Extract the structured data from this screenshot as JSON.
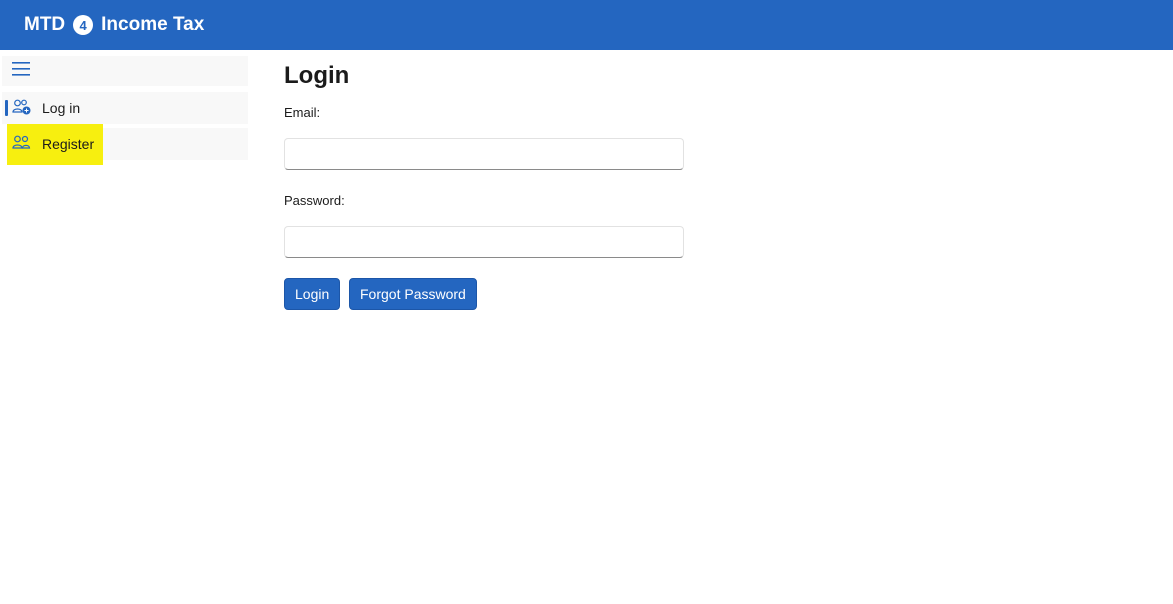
{
  "header": {
    "brand_prefix": "MTD",
    "brand_number": "4",
    "brand_suffix": "Income Tax",
    "background_color": "#2466c0"
  },
  "sidebar": {
    "menu_icon": "hamburger-icon",
    "items": [
      {
        "label": "Log in",
        "icon": "user-add-icon",
        "active": true
      },
      {
        "label": "Register",
        "icon": "users-icon",
        "highlighted": true
      }
    ],
    "highlight_color": "#f7ef0f"
  },
  "main": {
    "title": "Login",
    "email_label": "Email:",
    "email_value": "",
    "password_label": "Password:",
    "password_value": "",
    "login_button": "Login",
    "forgot_button": "Forgot Password"
  }
}
